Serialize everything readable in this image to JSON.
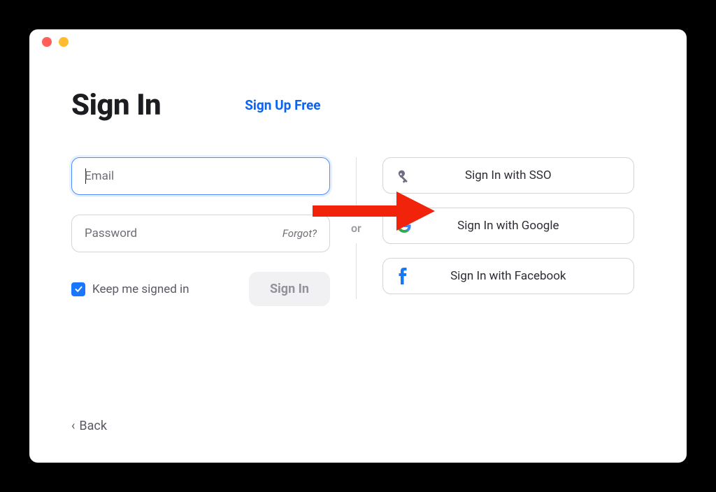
{
  "title": "Sign In",
  "signup_link": "Sign Up Free",
  "email": {
    "placeholder": "Email"
  },
  "password": {
    "placeholder": "Password",
    "forgot": "Forgot?"
  },
  "keep_signed_in": "Keep me signed in",
  "signin_button": "Sign In",
  "or": "or",
  "sso_button": "Sign In with SSO",
  "google_button": "Sign In with Google",
  "facebook_button": "Sign In with Facebook",
  "back_link": "Back"
}
